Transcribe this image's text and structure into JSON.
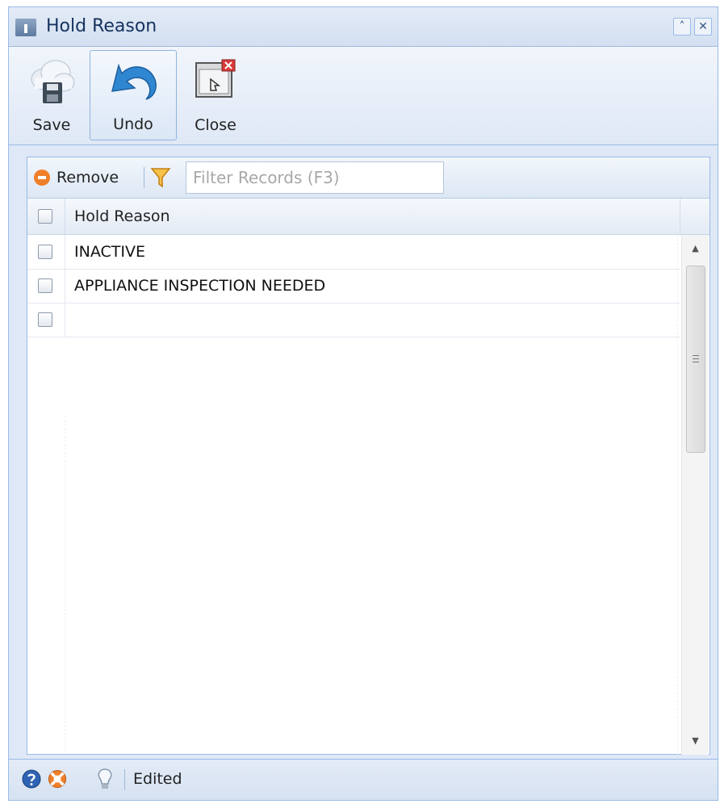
{
  "window": {
    "title": "Hold Reason",
    "collapse_glyph": "˄",
    "close_glyph": "✕"
  },
  "toolbar": {
    "save_label": "Save",
    "undo_label": "Undo",
    "close_label": "Close"
  },
  "grid": {
    "remove_label": "Remove",
    "filter_placeholder": "Filter Records (F3)",
    "column_header": "Hold Reason",
    "rows": [
      {
        "hold_reason": "INACTIVE",
        "checked": false
      },
      {
        "hold_reason": "APPLIANCE INSPECTION NEEDED",
        "checked": false
      },
      {
        "hold_reason": "",
        "checked": false
      }
    ]
  },
  "status": {
    "text": "Edited",
    "icons": [
      "help-icon",
      "support-lifebuoy-icon",
      "lightbulb-icon"
    ]
  },
  "colors": {
    "border": "#99bbe8",
    "panel_bg": "#dfe8f6",
    "remove_orange": "#f07f2a",
    "undo_blue": "#2f86d1"
  }
}
